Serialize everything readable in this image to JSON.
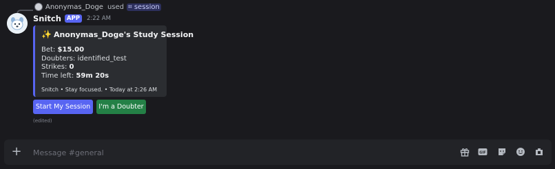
{
  "reply": {
    "username": "Anonymas_Doge",
    "used_text": "used",
    "command": "session"
  },
  "message": {
    "bot_name": "Snitch",
    "badge": "APP",
    "time": "2:22 AM",
    "edited": "(edited)"
  },
  "embed": {
    "title": "Anonymas_Doge's Study Session",
    "title_icon": "sparkles-icon",
    "accent_color": "#5865f2",
    "fields": [
      {
        "label": "Bet:",
        "value": "$15.00"
      },
      {
        "label": "Doubters:",
        "value": "identified_test"
      },
      {
        "label": "Strikes:",
        "value": "0"
      },
      {
        "label": "Time left:",
        "value": "59m 20s"
      }
    ],
    "footer": "Snitch • Stay focused. • Today at 2:26 AM"
  },
  "buttons": {
    "start": "Start My Session",
    "doubter": "I'm a Doubter"
  },
  "composer": {
    "placeholder": "Message #general",
    "icons": [
      "gift-icon",
      "gif-icon",
      "sticker-icon",
      "emoji-icon",
      "apps-icon"
    ]
  }
}
